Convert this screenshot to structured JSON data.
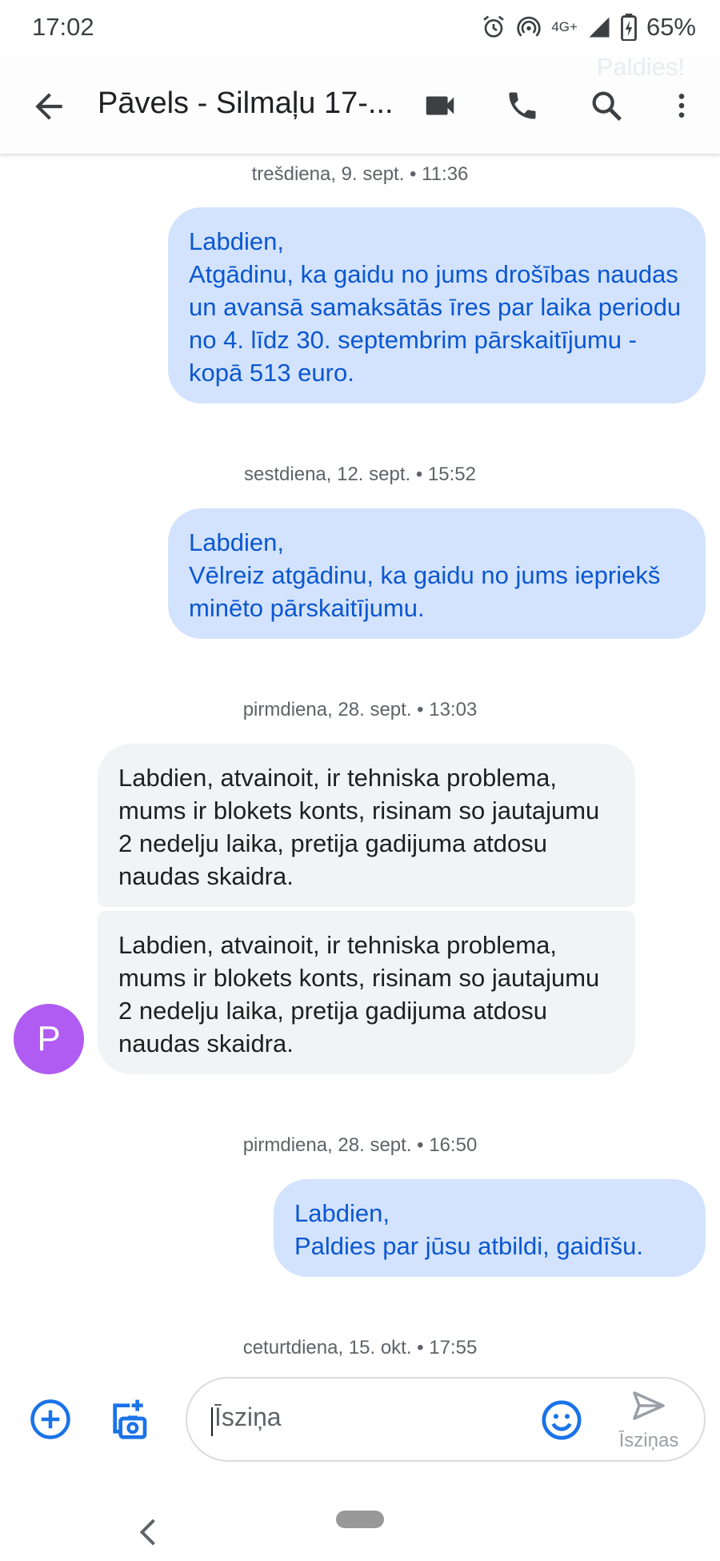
{
  "status_bar": {
    "time": "17:02",
    "battery": "65%",
    "network": "4G+",
    "icons": [
      "alarm-icon",
      "hotspot-icon",
      "signal-icon",
      "battery-icon"
    ]
  },
  "header": {
    "title": "Pāvels - Silmaļu 17-...",
    "ghost_text": "Paldies!",
    "icons": [
      "back-arrow-icon",
      "video-call-icon",
      "phone-icon",
      "search-icon",
      "more-vert-icon"
    ]
  },
  "thread": {
    "dates": [
      "trešdiena, 9. sept. • 11:36",
      "sestdiena, 12. sept. • 15:52",
      "pirmdiena, 28. sept. • 13:03",
      "pirmdiena, 28. sept. • 16:50",
      "ceturtdiena, 15. okt. • 17:55"
    ],
    "messages": [
      {
        "direction": "outgoing",
        "text": "Labdien,\nAtgādinu, ka gaidu no jums drošības naudas un avansā samaksātās īres par laika periodu no 4. līdz 30. septembrim pārskaitījumu - kopā 513 euro."
      },
      {
        "direction": "outgoing",
        "text": "Labdien,\nVēlreiz atgādinu, ka gaidu no jums iepriekš minēto pārskaitījumu."
      },
      {
        "direction": "incoming",
        "text": "Labdien, atvainoit, ir tehniska problema, mums ir blokets konts, risinam so jautajumu 2 nedelju laika, pretija gadijuma atdosu naudas skaidra."
      },
      {
        "direction": "incoming",
        "text": "Labdien, atvainoit, ir tehniska problema, mums ir blokets konts, risinam so jautajumu 2 nedelju laika, pretija gadijuma atdosu naudas skaidra."
      },
      {
        "direction": "outgoing",
        "text": "Labdien,\nPaldies par jūsu atbildi, gaidīšu."
      }
    ],
    "avatar_initial": "P"
  },
  "compose": {
    "placeholder": "Īsziņa",
    "send_label": "Īsziņas",
    "icons": [
      "add-circle-icon",
      "add-photo-icon",
      "emoji-icon",
      "send-icon"
    ]
  },
  "colors": {
    "accent": "#1a73e8",
    "outgoing_bubble": "#d3e3fd",
    "outgoing_text": "#0b57d0",
    "incoming_bubble": "#f1f3f4",
    "avatar": "#b05cf2"
  }
}
